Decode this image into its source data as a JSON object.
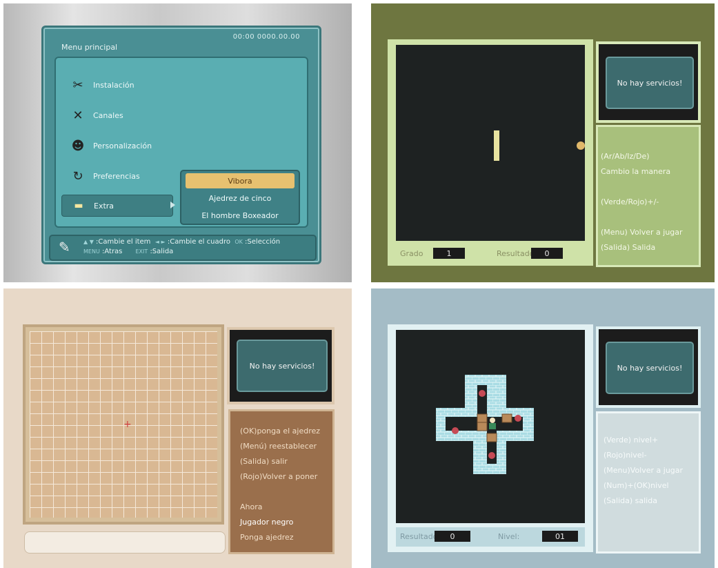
{
  "menu": {
    "title": "Menu principal",
    "clock": "00:00  0000.00.00",
    "items": [
      {
        "label": "Instalación",
        "icon": "tools-icon"
      },
      {
        "label": "Canales",
        "icon": "satellite-icon"
      },
      {
        "label": "Personalización",
        "icon": "user-icon"
      },
      {
        "label": "Preferencias",
        "icon": "refresh-icon"
      },
      {
        "label": "Extra",
        "icon": "gamepad-icon"
      }
    ],
    "submenu": [
      "Vibora",
      "Ajedrez de cinco",
      "El hombre Boxeador"
    ],
    "footer": {
      "line1_keys": "▲ ▼",
      "line1_a": ":Cambie el item",
      "line1_keys2": "◄ ►",
      "line1_b": ":Cambie el cuadro",
      "line1_keys3": "OK",
      "line1_c": ":Selección",
      "line2_keys": "MENU",
      "line2_a": ":Atras",
      "line2_keys2": "EXIT",
      "line2_b": ":Salida"
    }
  },
  "snake": {
    "no_service": "No hay servicios!",
    "help": [
      "(Ar/Ab/Iz/De)",
      "  Cambio la manera",
      "",
      "(Verde/Rojo)+/-",
      "",
      "(Menu) Volver a jugar",
      "(Salida) Salida"
    ],
    "grado_label": "Grado",
    "grado_value": "1",
    "result_label": "Resultado",
    "result_value": "0"
  },
  "gomoku": {
    "no_service": "No hay servicios!",
    "help": [
      "(OK)ponga el ajedrez",
      "(Menú) reestablecer",
      "(Salida) salir",
      "(Rojo)Volver a poner",
      "",
      "Ahora",
      "Jugador negro",
      "Ponga ajedrez"
    ]
  },
  "sokoban": {
    "no_service": "No hay servicios!",
    "help": [
      "(Verde) nivel+",
      "(Rojo)nivel-",
      "(Menu)Volver a jugar",
      "(Num)+(OK)nivel",
      "(Salida) salida"
    ],
    "result_label": "Resultado",
    "result_value": "0",
    "level_label": "Nivel:",
    "level_value": "01"
  },
  "colors": {
    "menu_teal": "#4a8f94",
    "highlight": "#e7c170",
    "snake_bg": "#6e7640",
    "gomoku_bg": "#e8d9c8",
    "sokoban_bg": "#a4bcc6"
  }
}
